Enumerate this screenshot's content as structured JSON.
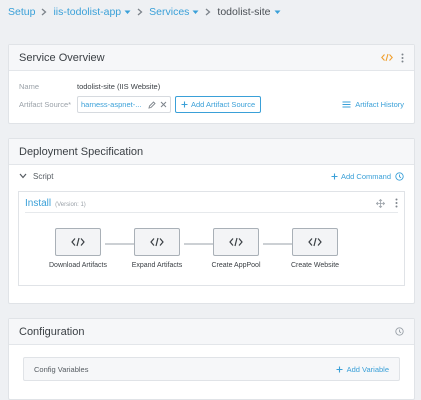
{
  "breadcrumb": {
    "items": [
      {
        "label": "Setup"
      },
      {
        "label": "iis-todolist-app"
      },
      {
        "label": "Services"
      },
      {
        "label": "todolist-site"
      }
    ]
  },
  "service_overview": {
    "title": "Service Overview",
    "name_label": "Name",
    "name_value": "todolist-site (IIS Website)",
    "artifact_source_label": "Artifact Source*",
    "artifact_source_value": "harness-aspnet-...",
    "add_artifact_source_label": "Add Artifact Source",
    "artifact_history_label": "Artifact History"
  },
  "deployment_specification": {
    "title": "Deployment Specification",
    "script_label": "Script",
    "add_command_label": "Add Command",
    "install": {
      "title": "Install",
      "version": "(Version: 1)",
      "steps": [
        {
          "label": "Download Artifacts"
        },
        {
          "label": "Expand Artifacts"
        },
        {
          "label": "Create AppPool"
        },
        {
          "label": "Create Website"
        }
      ]
    }
  },
  "configuration": {
    "title": "Configuration",
    "config_variables_label": "Config Variables",
    "add_variable_label": "Add Variable"
  },
  "colors": {
    "accent": "#3aa0d8",
    "header_bg": "#f6f7f9",
    "page_bg": "#eef0f3",
    "orange_icon": "#f0a030"
  },
  "icons": [
    "chevron-down-icon",
    "chevron-right-icon",
    "code-icon",
    "kebab-icon",
    "edit-icon",
    "close-icon",
    "plus-icon",
    "history-icon",
    "info-icon",
    "move-icon"
  ]
}
